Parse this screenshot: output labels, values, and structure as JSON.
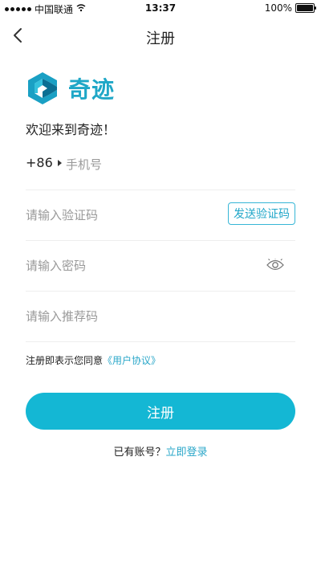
{
  "status_bar": {
    "carrier": "中国联通",
    "time": "13:37",
    "battery": "100%",
    "signal_dots": 5
  },
  "nav": {
    "back_icon": "chevron-left-icon",
    "title": "注册"
  },
  "brand": {
    "name": "奇迹",
    "logo_icon": "qiji-logo-icon",
    "accent": "#1fa7c7"
  },
  "welcome_text": "欢迎来到奇迹！",
  "phone": {
    "country_code": "+86",
    "placeholder": "手机号"
  },
  "verification": {
    "placeholder": "请输入验证码",
    "send_label": "发送验证码"
  },
  "password": {
    "placeholder": "请输入密码",
    "toggle_icon": "eye-icon"
  },
  "referral": {
    "placeholder": "请输入推荐码"
  },
  "agreement": {
    "text": "注册即表示您同意",
    "link": "《用户协议》"
  },
  "register_button": {
    "label": "注册",
    "color": "#14b7d4"
  },
  "login_prompt": {
    "text": "已有账号？",
    "link": "立即登录"
  }
}
